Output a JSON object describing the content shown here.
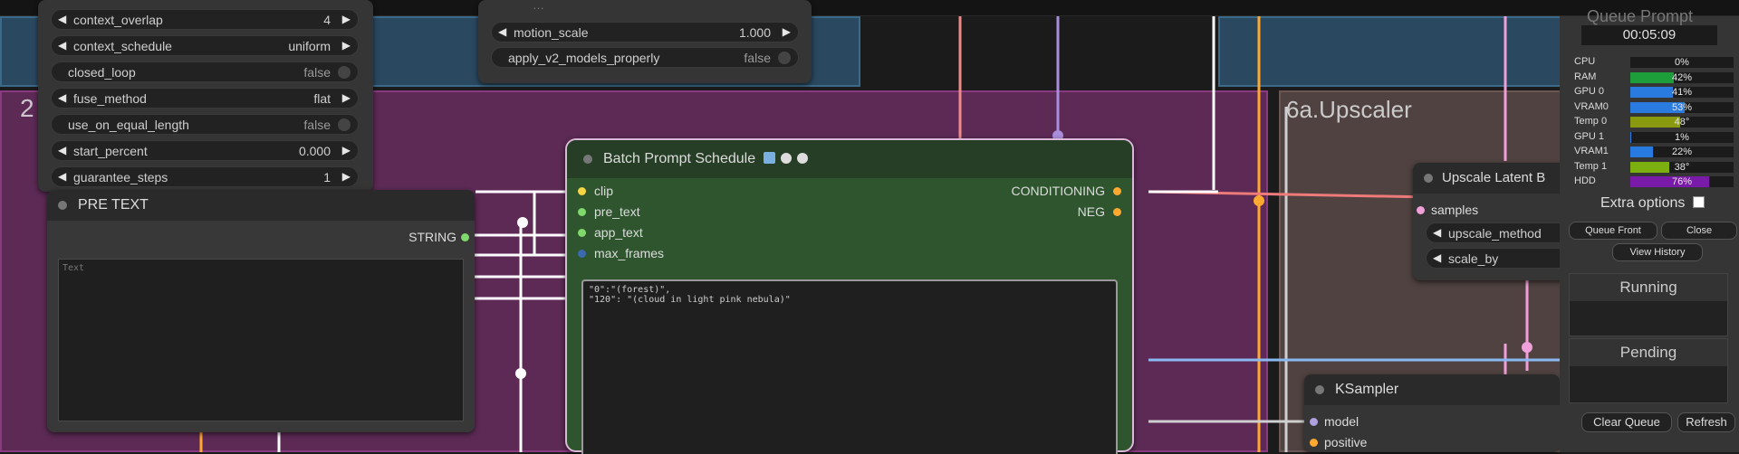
{
  "colors": {
    "canvas_bg": "#1b1b1b",
    "group_purple": "#6a2d62",
    "group_blue": "#2d4f6a",
    "group_upscaler": "#5a4a48",
    "node_bg": "#353535",
    "node_title_bg": "#2a2a2a",
    "batch_node_green": "#305a30",
    "wire_white": "#ffffff",
    "wire_orange": "#ffa931",
    "wire_pink": "#f0a0c8",
    "wire_blue": "#8ab8f0",
    "wire_violet": "#a98edb",
    "wire_red": "#ef7a7a"
  },
  "groups": {
    "group_2_title": "2",
    "upscaler_title": "6a.Upscaler"
  },
  "context_node": {
    "widgets": [
      {
        "label": "context_overlap",
        "value": "4",
        "type": "number"
      },
      {
        "label": "context_schedule",
        "value": "uniform",
        "type": "combo"
      },
      {
        "label": "closed_loop",
        "value": "false",
        "type": "toggle"
      },
      {
        "label": "fuse_method",
        "value": "flat",
        "type": "combo"
      },
      {
        "label": "use_on_equal_length",
        "value": "false",
        "type": "toggle"
      },
      {
        "label": "start_percent",
        "value": "0.000",
        "type": "number"
      },
      {
        "label": "guarantee_steps",
        "value": "1",
        "type": "number"
      }
    ]
  },
  "motion_node": {
    "faded_title": "…",
    "widgets": [
      {
        "label": "motion_scale",
        "value": "1.000",
        "type": "number"
      },
      {
        "label": "apply_v2_models_properly",
        "value": "false",
        "type": "toggle"
      }
    ]
  },
  "pre_text_node": {
    "title": "PRE TEXT",
    "output": "STRING",
    "placeholder": "Text"
  },
  "batch_node": {
    "title": "Batch Prompt Schedule",
    "badges": [
      "calendar-icon",
      "f-badge",
      "link-badge"
    ],
    "inputs": [
      "clip",
      "pre_text",
      "app_text",
      "max_frames"
    ],
    "outputs": [
      "CONDITIONING",
      "NEG"
    ],
    "text_line1": "\"0\":\"(forest)\",",
    "text_line2": "\"120\": \"(cloud in light pink nebula)\""
  },
  "upscale_node": {
    "title": "Upscale Latent B",
    "input": "samples",
    "widgets": [
      "upscale_method",
      "scale_by"
    ]
  },
  "ksampler_node": {
    "title": "KSampler",
    "inputs": [
      "model",
      "positive"
    ]
  },
  "queue": {
    "title_faded": "Queue Prompt",
    "timer": "00:05:09",
    "stats": [
      {
        "label": "CPU",
        "value": "0%",
        "fill": 0.0,
        "color": "#2a7be0"
      },
      {
        "label": "RAM",
        "value": "42%",
        "fill": 0.42,
        "color": "#1e9e3a"
      },
      {
        "label": "GPU 0",
        "value": "41%",
        "fill": 0.41,
        "color": "#2a7be0"
      },
      {
        "label": "VRAM0",
        "value": "53%",
        "fill": 0.53,
        "color": "#2a7be0"
      },
      {
        "label": "Temp 0",
        "value": "48°",
        "fill": 0.48,
        "color": "#8a9a10"
      },
      {
        "label": "GPU 1",
        "value": "1%",
        "fill": 0.01,
        "color": "#2a7be0"
      },
      {
        "label": "VRAM1",
        "value": "22%",
        "fill": 0.22,
        "color": "#2a7be0"
      },
      {
        "label": "Temp 1",
        "value": "38°",
        "fill": 0.38,
        "color": "#7bb010"
      },
      {
        "label": "HDD",
        "value": "76%",
        "fill": 0.76,
        "color": "#7a1aa8"
      }
    ],
    "extra_options": "Extra options",
    "queue_front": "Queue Front",
    "close": "Close",
    "view_history": "View History",
    "running": "Running",
    "pending": "Pending",
    "clear_queue": "Clear Queue",
    "refresh": "Refresh"
  }
}
